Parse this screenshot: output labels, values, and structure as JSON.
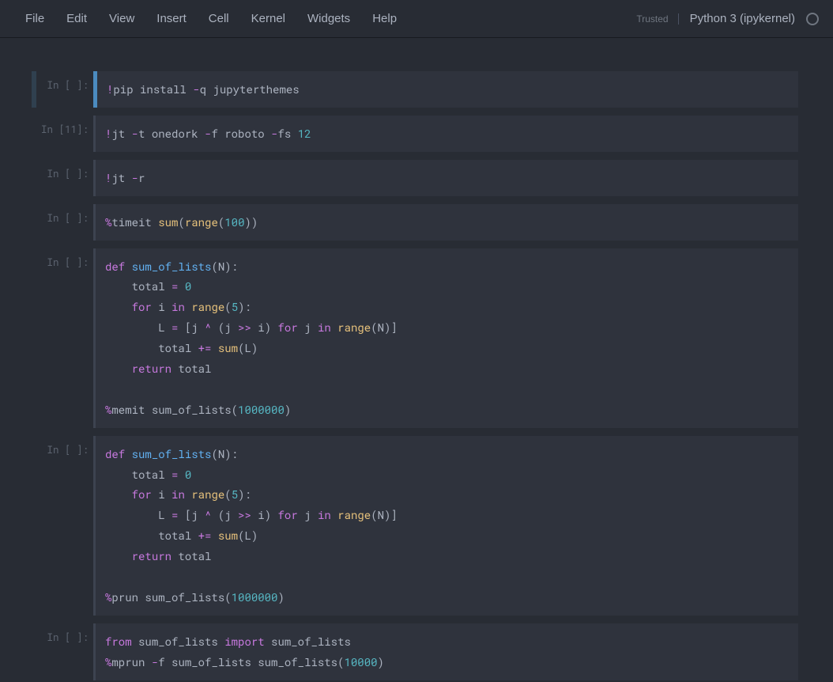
{
  "menubar": {
    "items": [
      "File",
      "Edit",
      "View",
      "Insert",
      "Cell",
      "Kernel",
      "Widgets",
      "Help"
    ],
    "trusted": "Trusted",
    "kernel": "Python 3 (ipykernel)"
  },
  "cells": [
    {
      "prompt": "In [ ]:",
      "selected": true,
      "tokens": [
        [
          [
            "op",
            "!"
          ],
          [
            "cmd",
            "pip install "
          ],
          [
            "op",
            "-"
          ],
          [
            "cmd",
            "q jupyterthemes"
          ]
        ]
      ]
    },
    {
      "prompt": "In [11]:",
      "tokens": [
        [
          [
            "op",
            "!"
          ],
          [
            "cmd",
            "jt "
          ],
          [
            "op",
            "-"
          ],
          [
            "cmd",
            "t onedork "
          ],
          [
            "op",
            "-"
          ],
          [
            "cmd",
            "f roboto "
          ],
          [
            "op",
            "-"
          ],
          [
            "cmd",
            "fs "
          ],
          [
            "num",
            "12"
          ]
        ]
      ]
    },
    {
      "prompt": "In [ ]:",
      "tokens": [
        [
          [
            "op",
            "!"
          ],
          [
            "cmd",
            "jt "
          ],
          [
            "op",
            "-"
          ],
          [
            "cmd",
            "r"
          ]
        ]
      ]
    },
    {
      "prompt": "In [ ]:",
      "tokens": [
        [
          [
            "op",
            "%"
          ],
          [
            "cmd",
            "timeit "
          ],
          [
            "bi",
            "sum"
          ],
          [
            "paren",
            "("
          ],
          [
            "bi",
            "range"
          ],
          [
            "paren",
            "("
          ],
          [
            "num",
            "100"
          ],
          [
            "paren",
            "))"
          ]
        ]
      ]
    },
    {
      "prompt": "In [ ]:",
      "tokens": [
        [
          [
            "kw",
            "def "
          ],
          [
            "def",
            "sum_of_lists"
          ],
          [
            "paren",
            "("
          ],
          [
            "var",
            "N"
          ],
          [
            "paren",
            ")"
          ],
          [
            "punct",
            ":"
          ]
        ],
        [
          [
            "var",
            "    total "
          ],
          [
            "op",
            "="
          ],
          [
            "var",
            " "
          ],
          [
            "num",
            "0"
          ]
        ],
        [
          [
            "var",
            "    "
          ],
          [
            "kw",
            "for"
          ],
          [
            "var",
            " i "
          ],
          [
            "kw",
            "in"
          ],
          [
            "var",
            " "
          ],
          [
            "bi",
            "range"
          ],
          [
            "paren",
            "("
          ],
          [
            "num",
            "5"
          ],
          [
            "paren",
            ")"
          ],
          [
            "punct",
            ":"
          ]
        ],
        [
          [
            "var",
            "        L "
          ],
          [
            "op",
            "="
          ],
          [
            "var",
            " "
          ],
          [
            "paren",
            "["
          ],
          [
            "var",
            "j "
          ],
          [
            "op",
            "^"
          ],
          [
            "var",
            " "
          ],
          [
            "paren",
            "("
          ],
          [
            "var",
            "j "
          ],
          [
            "op",
            ">>"
          ],
          [
            "var",
            " i"
          ],
          [
            "paren",
            ")"
          ],
          [
            "var",
            " "
          ],
          [
            "kw",
            "for"
          ],
          [
            "var",
            " j "
          ],
          [
            "kw",
            "in"
          ],
          [
            "var",
            " "
          ],
          [
            "bi",
            "range"
          ],
          [
            "paren",
            "("
          ],
          [
            "var",
            "N"
          ],
          [
            "paren",
            ")]"
          ]
        ],
        [
          [
            "var",
            "        total "
          ],
          [
            "op",
            "+="
          ],
          [
            "var",
            " "
          ],
          [
            "bi",
            "sum"
          ],
          [
            "paren",
            "("
          ],
          [
            "var",
            "L"
          ],
          [
            "paren",
            ")"
          ]
        ],
        [
          [
            "var",
            "    "
          ],
          [
            "kw",
            "return"
          ],
          [
            "var",
            " total"
          ]
        ],
        [
          [
            "var",
            ""
          ]
        ],
        [
          [
            "op",
            "%"
          ],
          [
            "cmd",
            "memit sum_of_lists"
          ],
          [
            "paren",
            "("
          ],
          [
            "num",
            "1000000"
          ],
          [
            "paren",
            ")"
          ]
        ]
      ]
    },
    {
      "prompt": "In [ ]:",
      "tokens": [
        [
          [
            "kw",
            "def "
          ],
          [
            "def",
            "sum_of_lists"
          ],
          [
            "paren",
            "("
          ],
          [
            "var",
            "N"
          ],
          [
            "paren",
            ")"
          ],
          [
            "punct",
            ":"
          ]
        ],
        [
          [
            "var",
            "    total "
          ],
          [
            "op",
            "="
          ],
          [
            "var",
            " "
          ],
          [
            "num",
            "0"
          ]
        ],
        [
          [
            "var",
            "    "
          ],
          [
            "kw",
            "for"
          ],
          [
            "var",
            " i "
          ],
          [
            "kw",
            "in"
          ],
          [
            "var",
            " "
          ],
          [
            "bi",
            "range"
          ],
          [
            "paren",
            "("
          ],
          [
            "num",
            "5"
          ],
          [
            "paren",
            ")"
          ],
          [
            "punct",
            ":"
          ]
        ],
        [
          [
            "var",
            "        L "
          ],
          [
            "op",
            "="
          ],
          [
            "var",
            " "
          ],
          [
            "paren",
            "["
          ],
          [
            "var",
            "j "
          ],
          [
            "op",
            "^"
          ],
          [
            "var",
            " "
          ],
          [
            "paren",
            "("
          ],
          [
            "var",
            "j "
          ],
          [
            "op",
            ">>"
          ],
          [
            "var",
            " i"
          ],
          [
            "paren",
            ")"
          ],
          [
            "var",
            " "
          ],
          [
            "kw",
            "for"
          ],
          [
            "var",
            " j "
          ],
          [
            "kw",
            "in"
          ],
          [
            "var",
            " "
          ],
          [
            "bi",
            "range"
          ],
          [
            "paren",
            "("
          ],
          [
            "var",
            "N"
          ],
          [
            "paren",
            ")]"
          ]
        ],
        [
          [
            "var",
            "        total "
          ],
          [
            "op",
            "+="
          ],
          [
            "var",
            " "
          ],
          [
            "bi",
            "sum"
          ],
          [
            "paren",
            "("
          ],
          [
            "var",
            "L"
          ],
          [
            "paren",
            ")"
          ]
        ],
        [
          [
            "var",
            "    "
          ],
          [
            "kw",
            "return"
          ],
          [
            "var",
            " total"
          ]
        ],
        [
          [
            "var",
            ""
          ]
        ],
        [
          [
            "op",
            "%"
          ],
          [
            "cmd",
            "prun sum_of_lists"
          ],
          [
            "paren",
            "("
          ],
          [
            "num",
            "1000000"
          ],
          [
            "paren",
            ")"
          ]
        ]
      ]
    },
    {
      "prompt": "In [ ]:",
      "tokens": [
        [
          [
            "kw",
            "from"
          ],
          [
            "var",
            " sum_of_lists "
          ],
          [
            "kw",
            "import"
          ],
          [
            "var",
            " sum_of_lists"
          ]
        ],
        [
          [
            "op",
            "%"
          ],
          [
            "cmd",
            "mprun "
          ],
          [
            "op",
            "-"
          ],
          [
            "cmd",
            "f sum_of_lists sum_of_lists"
          ],
          [
            "paren",
            "("
          ],
          [
            "num",
            "10000"
          ],
          [
            "paren",
            ")"
          ]
        ]
      ]
    }
  ]
}
